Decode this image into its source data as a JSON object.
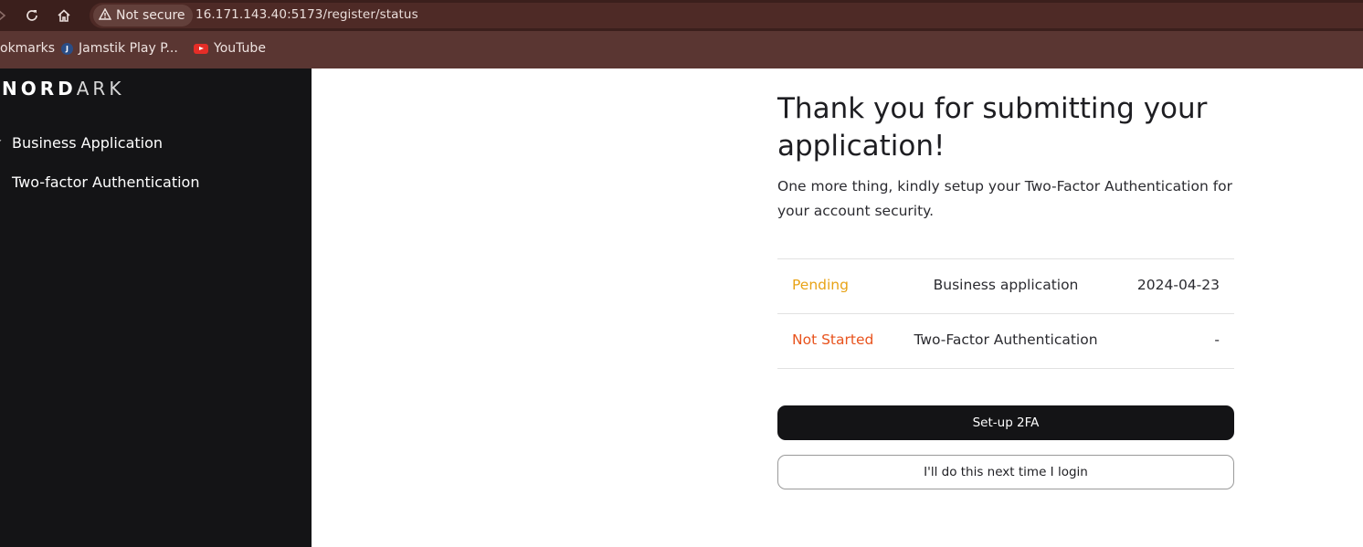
{
  "browser": {
    "security_label": "Not secure",
    "url": "16.171.143.40:5173/register/status",
    "bookmarks": [
      {
        "label": "okmarks"
      },
      {
        "label": "Jamstik Play P..."
      },
      {
        "label": "YouTube"
      }
    ]
  },
  "sidebar": {
    "logo_bold": "NORD",
    "logo_light": "ARK",
    "steps": [
      {
        "label": "Business Application",
        "mark": "✓"
      },
      {
        "label": "Two-factor Authentication",
        "mark": "›"
      }
    ]
  },
  "main": {
    "title": "Thank you for submitting your application!",
    "description": "One more thing, kindly setup your Two-Factor Authentication for your account security.",
    "rows": [
      {
        "status": "Pending",
        "status_color": "#e8a317",
        "name": "Business application",
        "date": "2024-04-23"
      },
      {
        "status": "Not Started",
        "status_color": "#e8531d",
        "name": "Two-Factor Authentication",
        "date": "-"
      }
    ],
    "primary_button": "Set-up 2FA",
    "secondary_button": "I'll do this next time I login"
  },
  "colors": {
    "sidebar_bg": "#141416",
    "toolbar_bg": "#3b1f1c",
    "pending": "#e8a317",
    "not_started": "#e8531d"
  }
}
